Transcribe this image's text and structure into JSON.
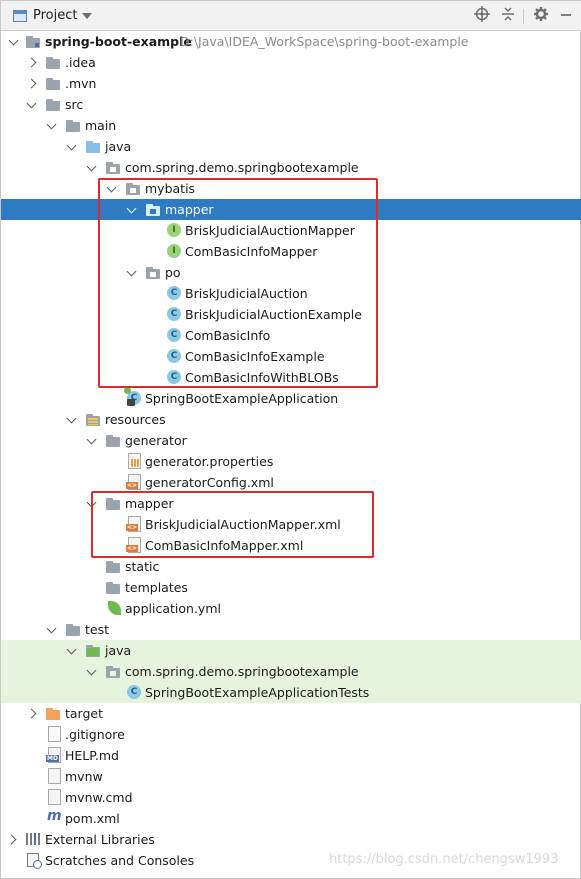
{
  "toolbar": {
    "title": "Project",
    "icons": [
      "project-view-icon",
      "chevron-down-icon",
      "locate-icon",
      "collapse-all-icon",
      "gear-icon",
      "minimize-icon"
    ]
  },
  "tree": {
    "root": {
      "name": "spring-boot-example",
      "path": "D:\\Java\\IDEA_WorkSpace\\spring-boot-example"
    },
    "idea": ".idea",
    "mvn": ".mvn",
    "src": "src",
    "main": "main",
    "java": "java",
    "package": "com.spring.demo.springbootexample",
    "mybatis": "mybatis",
    "mapper_pkg": "mapper",
    "mapper_classes": [
      "BriskJudicialAuctionMapper",
      "ComBasicInfoMapper"
    ],
    "po": "po",
    "po_classes": [
      "BriskJudicialAuction",
      "BriskJudicialAuctionExample",
      "ComBasicInfo",
      "ComBasicInfoExample",
      "ComBasicInfoWithBLOBs"
    ],
    "app_class": "SpringBootExampleApplication",
    "resources": "resources",
    "generator": "generator",
    "generator_files": [
      "generator.properties",
      "generatorConfig.xml"
    ],
    "mapper_res": "mapper",
    "mapper_xmls": [
      "BriskJudicialAuctionMapper.xml",
      "ComBasicInfoMapper.xml"
    ],
    "static": "static",
    "templates": "templates",
    "application_yml": "application.yml",
    "test": "test",
    "test_java": "java",
    "test_package": "com.spring.demo.springbootexample",
    "test_class": "SpringBootExampleApplicationTests",
    "target": "target",
    "root_files": [
      ".gitignore",
      "HELP.md",
      "mvnw",
      "mvnw.cmd",
      "pom.xml"
    ],
    "external_libraries": "External Libraries",
    "scratches": "Scratches and Consoles"
  },
  "colors": {
    "selection": "#2f7bc1",
    "test_bg": "#e6f3dd",
    "highlight_box": "#e0292a"
  },
  "watermark": "https://blog.csdn.net/chengsw1993"
}
